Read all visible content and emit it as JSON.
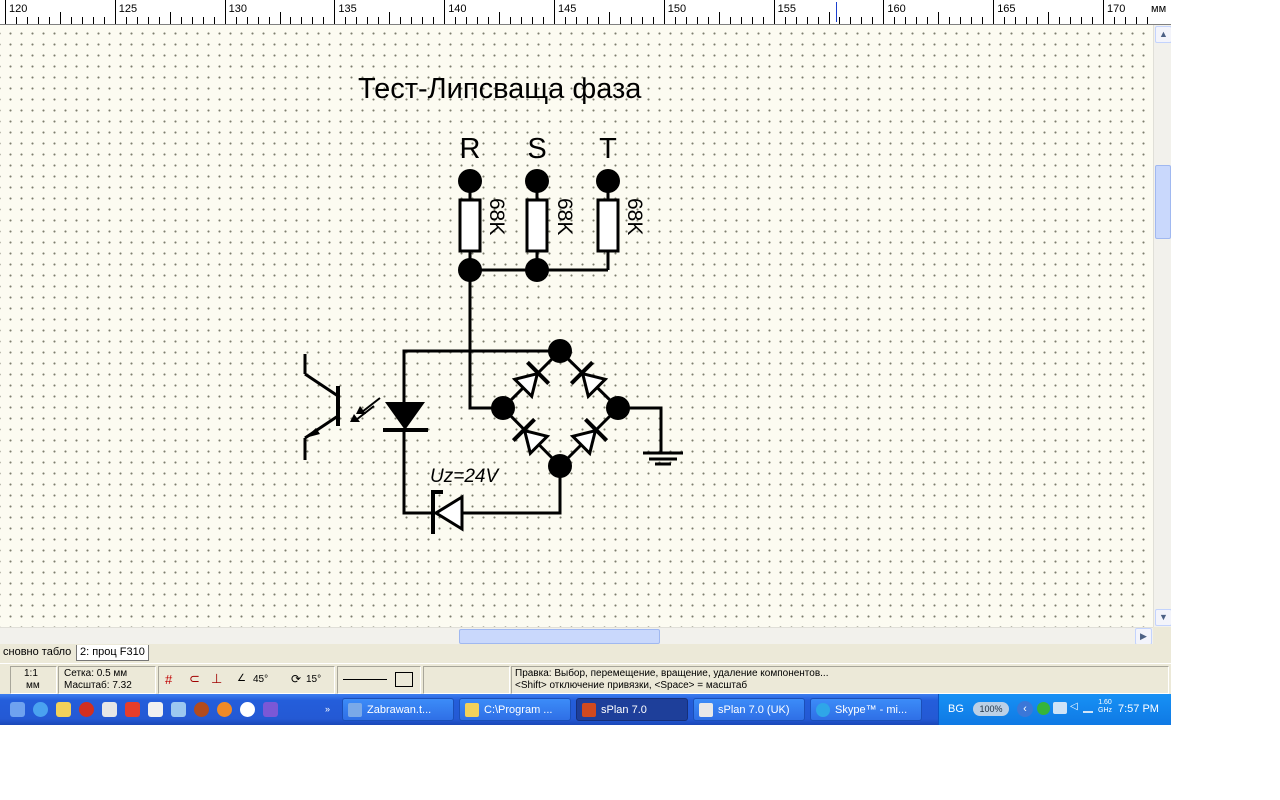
{
  "ruler": {
    "unit": "мм",
    "labels": [
      "120",
      "125",
      "130",
      "135",
      "140",
      "145",
      "150",
      "155",
      "160",
      "165",
      "170"
    ]
  },
  "schematic": {
    "title": "Тест-Липсваща фаза",
    "phases": [
      "R",
      "S",
      "T"
    ],
    "resistors": [
      "68K",
      "68K",
      "68K"
    ],
    "zener_label": "Uz=24V"
  },
  "tabs": {
    "tab1": "сновно табло",
    "tab2": "2: проц F310"
  },
  "status": {
    "scale_ratio": "1:1",
    "scale_unit": "мм",
    "grid": "Сетка: 0.5 мм",
    "zoom": "Масштаб:  7.32",
    "angle1": "45°",
    "angle2": "15°",
    "hint_line1": "Правка: Выбор, перемещение, вращение, удаление компонентов...",
    "hint_line2": "<Shift> отключение привязки, <Space> = масштаб"
  },
  "taskbar": {
    "buttons": [
      "Zabrawan.t...",
      "C:\\Program ...",
      "sPlan 7.0",
      "sPlan 7.0 (UK)",
      "Skype™ - mi..."
    ],
    "active_index": 2,
    "lang": "BG",
    "battery": "100%",
    "cpu": "1.60 GHz",
    "clock": "7:57 PM"
  },
  "colors": {
    "canvas_bg": "#fcfbf1",
    "taskbar_blue": "#245edb",
    "tray_blue": "#0f79e4"
  }
}
